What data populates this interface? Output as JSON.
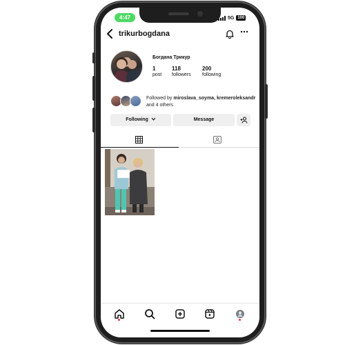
{
  "status_bar": {
    "time": "4:47",
    "network": "5G",
    "battery": "100"
  },
  "header": {
    "username": "trikurbogdana",
    "back_icon": "chevron-left-icon",
    "bell_icon": "bell-icon",
    "more_icon": "ellipsis-icon"
  },
  "profile": {
    "full_name": "Богдана Трикур",
    "stats": [
      {
        "value": "1",
        "label": "post"
      },
      {
        "value": "118",
        "label": "followers"
      },
      {
        "value": "200",
        "label": "following"
      }
    ],
    "followed_by": {
      "prefix": "Followed by",
      "users": "miroslava_soyma, kremeroleksandr",
      "suffix": "and 4 others"
    }
  },
  "actions": {
    "following": "Following",
    "message": "Message"
  },
  "tabs": [
    "posts-grid",
    "tagged"
  ],
  "bottom_nav": [
    "home-icon",
    "search-icon",
    "create-icon",
    "reels-icon",
    "profile-avatar"
  ],
  "colors": {
    "accent_green": "#4cd964",
    "notification_dot": "#ff3040",
    "button_bg": "#efefef"
  }
}
